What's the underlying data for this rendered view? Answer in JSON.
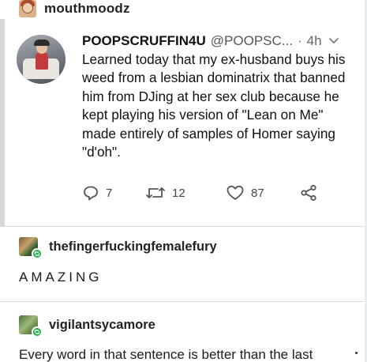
{
  "post": {
    "author": "mouthmoodz"
  },
  "tweet": {
    "display_name": "POOPSCRUFFIN4U",
    "handle": "@POOPSC...",
    "separator": "·",
    "time": "4h",
    "text": "Learned today that my ex-husband buys his weed from a lesbian dominatrix that banned him from DJing at her sex club because he kept playing his version of \"Lean on Me\" made entirely of samples of Homer saying \"d'oh\".",
    "actions": {
      "replies": "7",
      "retweets": "12",
      "likes": "87"
    },
    "icons": [
      "reply-icon",
      "retweet-icon",
      "like-icon",
      "share-icon",
      "chevron-down-icon"
    ],
    "colors": {
      "text": "#111111",
      "muted": "#555555"
    }
  },
  "reblogs": [
    {
      "username": "thefingerfuckingfemalefury",
      "text": "AMAZING"
    },
    {
      "username": "vigilantsycamore",
      "text": "Every word in that sentence is better than the last"
    }
  ],
  "colors": {
    "reblog_badge": "#22b04b",
    "divider": "#d9d9d9"
  }
}
